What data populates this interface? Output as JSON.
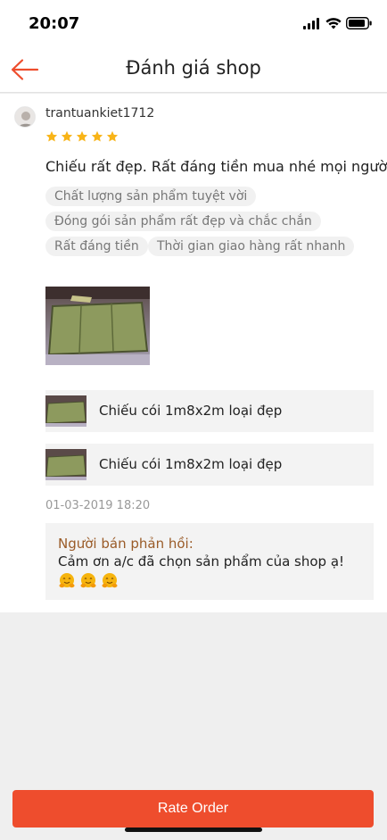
{
  "status_bar": {
    "time": "20:07"
  },
  "header": {
    "title": "Đánh giá shop"
  },
  "review": {
    "username": "trantuankiet1712",
    "rating": 5,
    "comment": "Chiếu rất đẹp. Rất đáng tiền mua nhé mọi người .",
    "tags": [
      "Chất lượng sản phẩm tuyệt vời",
      "Đóng gói sản phẩm rất đẹp và chắc chắn",
      "Rất đáng tiền",
      "Thời gian giao hàng rất nhanh"
    ],
    "products": [
      {
        "name": "Chiếu cói 1m8x2m loại đẹp"
      },
      {
        "name": "Chiếu cói 1m8x2m loại đẹp"
      }
    ],
    "date": "01-03-2019 18:20",
    "seller_reply": {
      "label": "Người bán phản hồi:",
      "text": "Cảm ơn a/c đã chọn sản phẩm của shop ạ!",
      "emoji": [
        "hugging-face-icon",
        "hugging-face-icon",
        "hugging-face-icon"
      ]
    }
  },
  "footer": {
    "rate_button_label": "Rate Order"
  },
  "colors": {
    "accent": "#ee4d2d",
    "star": "#f8b418",
    "reply_label": "#9a5b28"
  }
}
